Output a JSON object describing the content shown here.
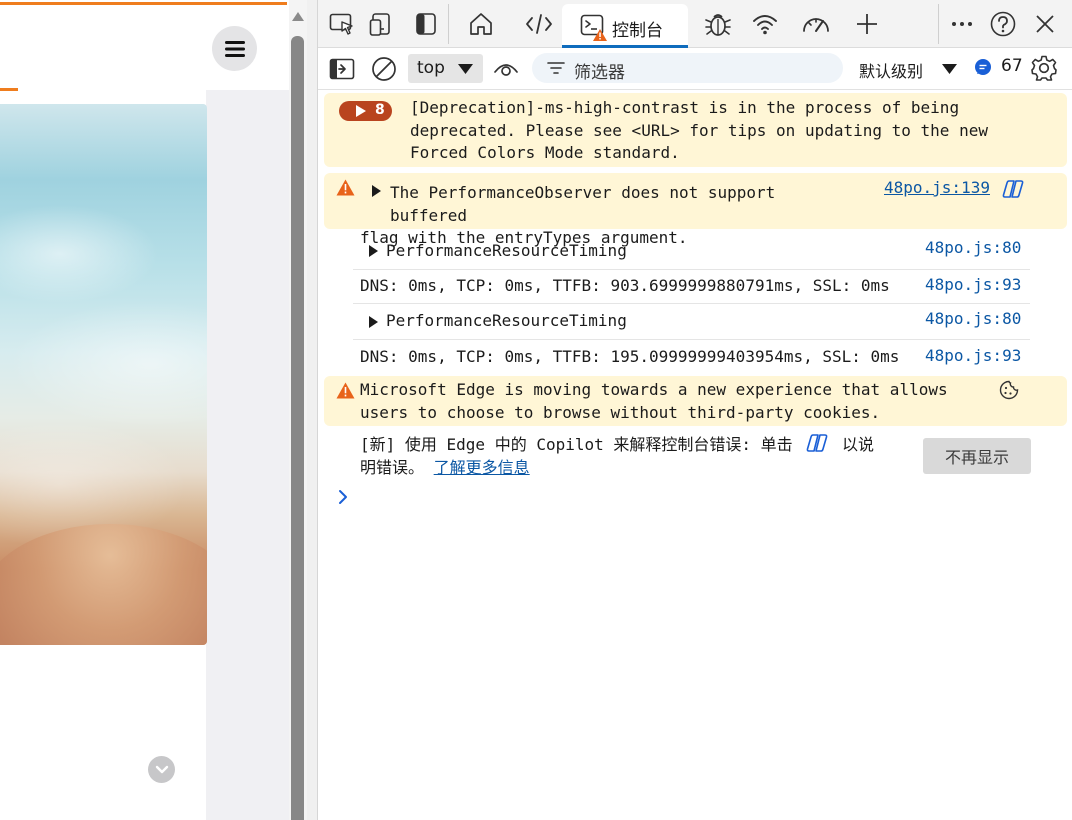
{
  "devtools": {
    "tabs": {
      "console_label": "控制台"
    },
    "toolbar": {
      "context": "top",
      "filter_placeholder": "筛选器",
      "levels": "默认级别",
      "issues_count": "67"
    },
    "messages": [
      {
        "type": "warning-group",
        "count": "8",
        "lines": [
          "[Deprecation]-ms-high-contrast is in the process of being",
          "deprecated. Please see <URL> for tips on updating to the new",
          "Forced Colors Mode standard."
        ]
      },
      {
        "type": "warning",
        "lines": [
          "The PerformanceObserver does not support buffered",
          "flag with the entryTypes argument."
        ],
        "source": "48po.js:139"
      },
      {
        "type": "object",
        "text": "PerformanceResourceTiming",
        "source": "48po.js:80"
      },
      {
        "type": "log",
        "text": "DNS: 0ms, TCP: 0ms, TTFB: 903.6999999880791ms, SSL: 0ms",
        "source": "48po.js:93"
      },
      {
        "type": "object",
        "text": "PerformanceResourceTiming",
        "source": "48po.js:80"
      },
      {
        "type": "log",
        "text": "DNS: 0ms, TCP: 0ms, TTFB: 195.09999999403954ms, SSL: 0ms",
        "source": "48po.js:93"
      },
      {
        "type": "warning",
        "lines": [
          "Microsoft Edge is moving towards a new experience that allows",
          "users to choose to browse without third-party cookies."
        ]
      }
    ],
    "copilot_hint": {
      "line1_a": "[新] 使用 Edge 中的 Copilot 来解释控制台错误: 单击",
      "line1_b": "以说",
      "line2_prefix": "明错误。",
      "learn_more": "了解更多信息",
      "dismiss": "不再显示"
    }
  },
  "colors": {
    "accent": "#0f6cbd",
    "warning_bg": "#fff6d6",
    "warning_icon": "#e8631a",
    "page_accent": "#ef7d1e"
  }
}
